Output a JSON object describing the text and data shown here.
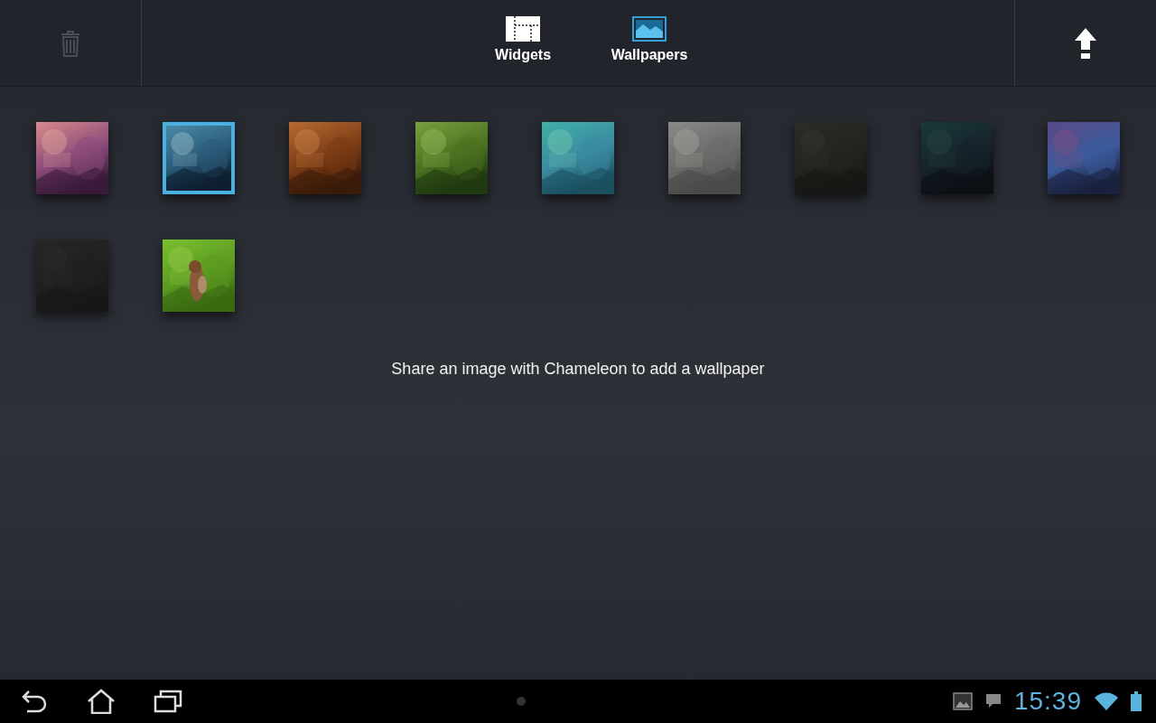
{
  "toolbar": {
    "delete": {
      "disabled": true
    },
    "tabs": [
      {
        "kind": "widgets",
        "label": "Widgets",
        "selected": false
      },
      {
        "kind": "wallpapers",
        "label": "Wallpapers",
        "selected": true
      }
    ]
  },
  "wallpapers": [
    {
      "kind": "picture",
      "selected": false
    },
    {
      "kind": "picture",
      "selected": true
    },
    {
      "kind": "picture",
      "selected": false
    },
    {
      "kind": "picture",
      "selected": false
    },
    {
      "kind": "picture",
      "selected": false
    },
    {
      "kind": "picture",
      "selected": false
    },
    {
      "kind": "picture",
      "selected": false
    },
    {
      "kind": "picture",
      "selected": false
    },
    {
      "kind": "picture",
      "selected": false
    },
    {
      "kind": "picture",
      "selected": false
    },
    {
      "kind": "picture",
      "selected": false
    }
  ],
  "hint": "Share an image with Chameleon to add a wallpaper",
  "status_bar": {
    "time": "15:39"
  }
}
